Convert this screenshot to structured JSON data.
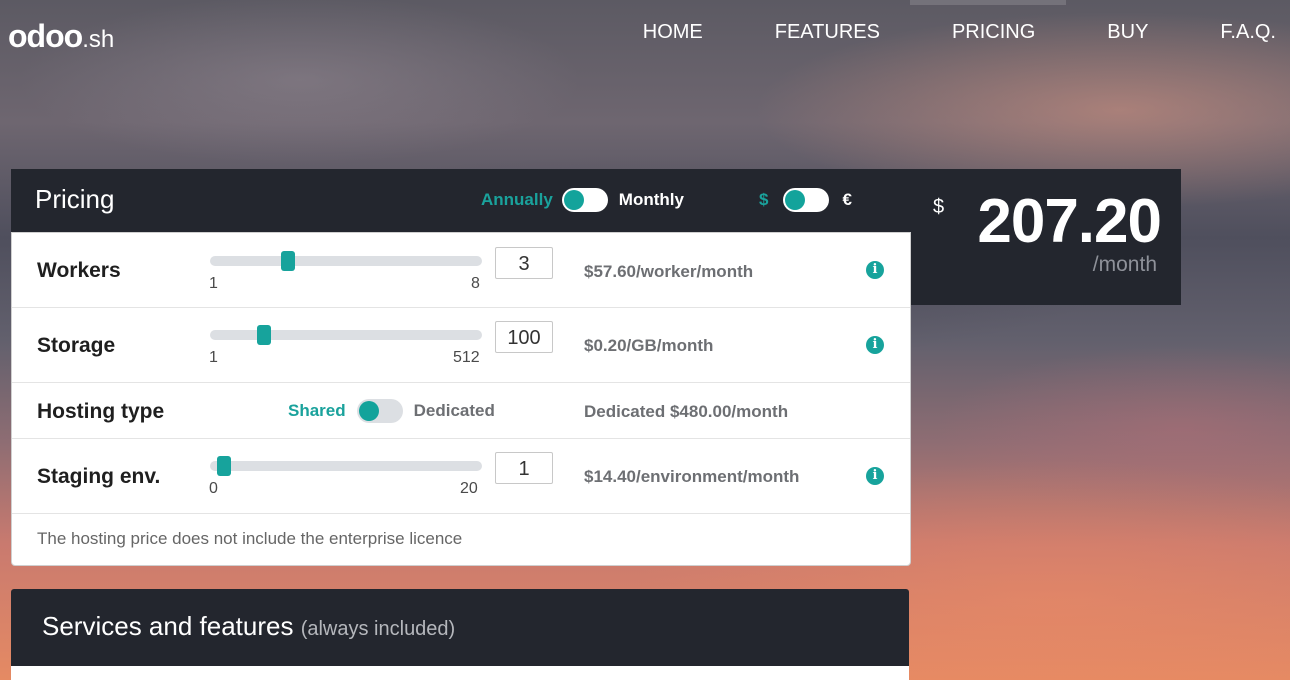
{
  "header": {
    "logo_main": "odoo",
    "logo_suffix": ".sh",
    "nav": [
      "HOME",
      "FEATURES",
      "PRICING",
      "BUY",
      "F.A.Q."
    ],
    "active_nav": "PRICING"
  },
  "pricing": {
    "title": "Pricing",
    "billing": {
      "left": "Annually",
      "right": "Monthly",
      "selected": "Annually"
    },
    "currency": {
      "left": "$",
      "right": "€",
      "selected": "$"
    },
    "total": {
      "currency_symbol": "$",
      "amount": "207.20",
      "period": "/month"
    },
    "rows": {
      "workers": {
        "label": "Workers",
        "value": "3",
        "min": "1",
        "max": "8",
        "price": "$57.60/worker/month",
        "level": 0.2857
      },
      "storage": {
        "label": "Storage",
        "value": "100",
        "min": "1",
        "max": "512",
        "price": "$0.20/GB/month",
        "level": 0.2
      },
      "hosting": {
        "label": "Hosting type",
        "left": "Shared",
        "right": "Dedicated",
        "selected": "Shared",
        "price": "Dedicated $480.00/month"
      },
      "staging": {
        "label": "Staging env.",
        "value": "1",
        "min": "0",
        "max": "20",
        "price": "$14.40/environment/month",
        "level": 0.05
      }
    },
    "note": "The hosting price does not include the enterprise licence",
    "info_icon": "i"
  },
  "services": {
    "title": "Services and features",
    "subtitle": "(always included)"
  },
  "colors": {
    "accent": "#17a39c",
    "dark": "#23262e"
  }
}
